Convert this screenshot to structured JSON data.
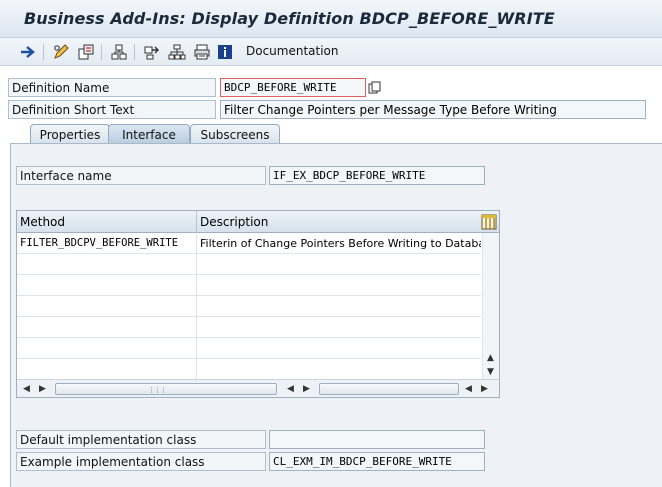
{
  "window": {
    "title": "Business Add-Ins: Display Definition BDCP_BEFORE_WRITE"
  },
  "toolbar": {
    "icons": [
      "back-arrow-icon",
      "pencil-display-icon",
      "object-list-icon",
      "hierarchy-icon",
      "where-used-icon",
      "tree-icon",
      "printer-icon",
      "info-icon"
    ],
    "documentation_label": "Documentation"
  },
  "header": {
    "definition_name_label": "Definition Name",
    "definition_name_value": "BDCP_BEFORE_WRITE",
    "short_text_label": "Definition Short Text",
    "short_text_value": "Filter Change Pointers per Message Type Before Writing"
  },
  "tabs": [
    {
      "label": "Properties",
      "active": false
    },
    {
      "label": "Interface",
      "active": true
    },
    {
      "label": "Subscreens",
      "active": false
    }
  ],
  "interface": {
    "name_label": "Interface name",
    "name_value": "IF_EX_BDCP_BEFORE_WRITE"
  },
  "methods_table": {
    "columns": [
      "Method",
      "Description"
    ],
    "rows": [
      {
        "method": "FILTER_BDCPV_BEFORE_WRITE",
        "description": "Filterin of Change Pointers Before Writing to Databa"
      }
    ]
  },
  "classes": {
    "default_label": "Default implementation class",
    "default_value": "",
    "example_label": "Example implementation class",
    "example_value": "CL_EXM_IM_BDCP_BEFORE_WRITE"
  },
  "colors": {
    "accent": "#1a4f9c",
    "required_border": "#e06060",
    "panel_bg": "#eef2f6"
  }
}
